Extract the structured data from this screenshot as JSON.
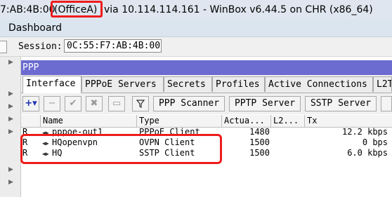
{
  "window": {
    "title_prefix": "7:AB:4B:00",
    "title_name": "(OfficeA)",
    "title_suffix": "via 10.114.114.161 - WinBox v6.44.5 on CHR (x86_64)"
  },
  "menubar": {
    "dashboard_label": "Dashboard"
  },
  "session": {
    "label": "Session:",
    "value": "0C:55:F7:AB:4B:00"
  },
  "ppp_window": {
    "title": "PPP",
    "tabs": [
      {
        "label": "Interface",
        "active": true
      },
      {
        "label": "PPPoE Servers"
      },
      {
        "label": "Secrets"
      },
      {
        "label": "Profiles"
      },
      {
        "label": "Active Connections"
      },
      {
        "label": "L2T"
      }
    ],
    "toolbar": {
      "add_icon": "plus-icon",
      "remove_icon": "minus-icon",
      "enable_icon": "check-icon",
      "disable_icon": "x-icon",
      "comment_icon": "comment-icon",
      "filter_icon": "filter-icon",
      "buttons": [
        "PPP Scanner",
        "PPTP Server",
        "SSTP Server"
      ]
    },
    "columns": [
      "Name",
      "Type",
      "Actua...",
      "L2...",
      "Tx"
    ],
    "rows": [
      {
        "flag": "R",
        "name": "pppoe-out1",
        "type": "PPPoE Client",
        "actual_mtu": "1480",
        "l2mtu": "",
        "tx": "12.2 kbps"
      },
      {
        "flag": "R",
        "name": "HQopenvpn",
        "type": "OVPN Client",
        "actual_mtu": "1500",
        "l2mtu": "",
        "tx": "0 bps"
      },
      {
        "flag": "R",
        "name": "HQ",
        "type": "SSTP Client",
        "actual_mtu": "1500",
        "l2mtu": "",
        "tx": "6.0 kbps"
      }
    ]
  },
  "colors": {
    "accent_highlight": "#ee1c1c",
    "ppp_header_bg": "#6b6bd0",
    "titlebar_bg": "#dfe6ef"
  }
}
